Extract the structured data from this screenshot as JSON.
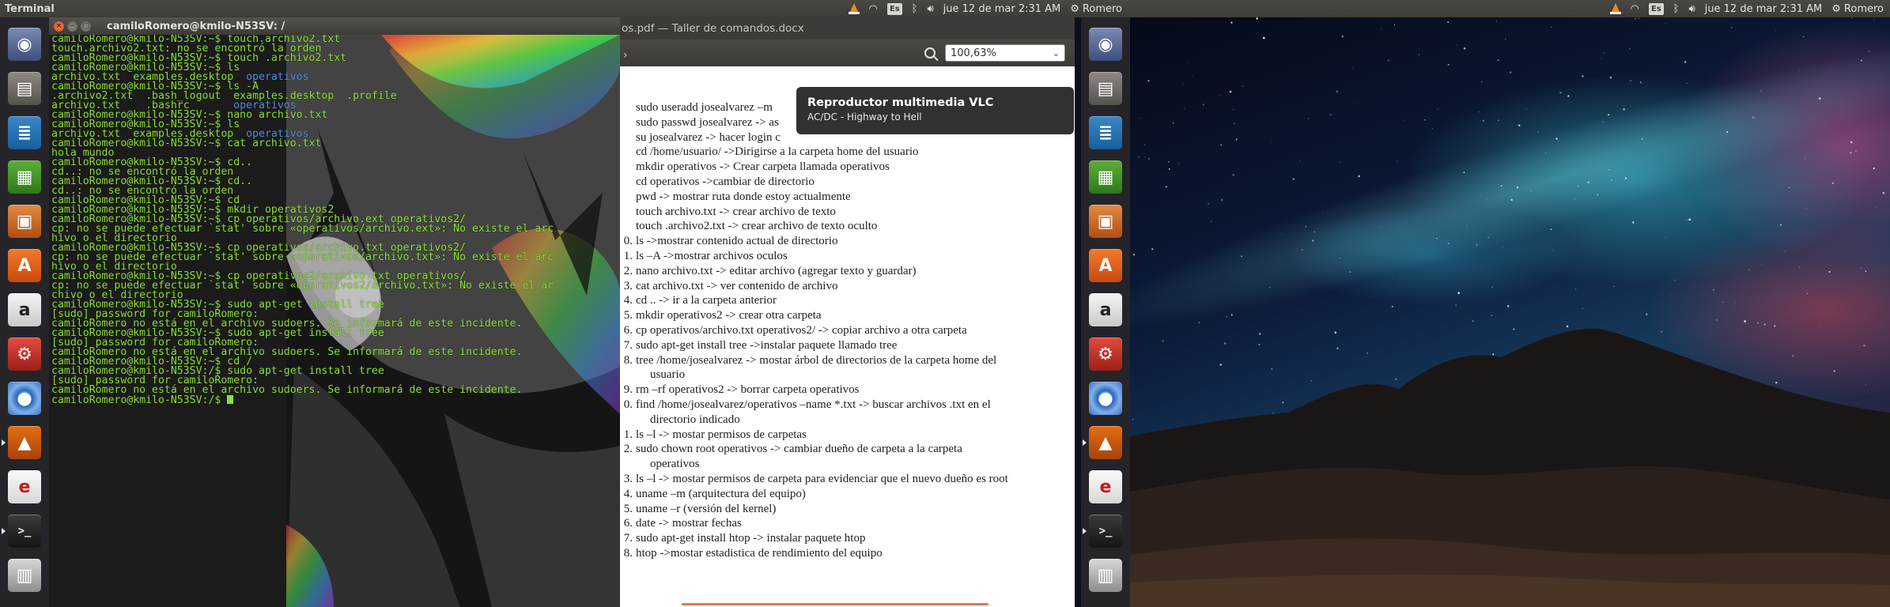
{
  "left_panel": {
    "app_title": "Terminal",
    "keyboard_layout": "Es",
    "datetime": "jue 12 de mar  2:31 AM",
    "username": "Romero"
  },
  "right_panel": {
    "keyboard_layout": "Es",
    "datetime": "jue 12 de mar  2:31 AM",
    "username": "Romero"
  },
  "launcher": [
    {
      "name": "dash-home",
      "glyph": "◉"
    },
    {
      "name": "files",
      "glyph": "▤"
    },
    {
      "name": "libreoffice-writer",
      "glyph": "≣"
    },
    {
      "name": "libreoffice-calc",
      "glyph": "▦"
    },
    {
      "name": "libreoffice-impress",
      "glyph": "▣"
    },
    {
      "name": "ubuntu-software-center",
      "glyph": "A"
    },
    {
      "name": "amazon",
      "glyph": "a"
    },
    {
      "name": "system-settings",
      "glyph": "⚙"
    },
    {
      "name": "chromium",
      "glyph": "●"
    },
    {
      "name": "vlc",
      "glyph": "▲"
    },
    {
      "name": "help-desk",
      "glyph": "e"
    },
    {
      "name": "terminal",
      "glyph": ">_"
    },
    {
      "name": "trash",
      "glyph": "▥"
    }
  ],
  "terminal": {
    "title": "camiloRomero@kmilo-N53SV: /",
    "lines": [
      "camiloRomero@kmilo-N53SV:~$ touch.archivo2.txt",
      "touch.archivo2.txt: no se encontró la orden",
      "camiloRomero@kmilo-N53SV:~$ touch .archivo2.txt",
      "camiloRomero@kmilo-N53SV:~$ ls",
      "archivo.txt  examples.desktop  operativos",
      "camiloRomero@kmilo-N53SV:~$ ls -A",
      ".archivo2.txt  .bash_logout  examples.desktop  .profile",
      "archivo.txt    .bashrc       operativos",
      "camiloRomero@kmilo-N53SV:~$ nano archivo.txt",
      "camiloRomero@kmilo-N53SV:~$ ls",
      "archivo.txt  examples.desktop  operativos",
      "camiloRomero@kmilo-N53SV:~$ cat archivo.txt",
      "hola mundo",
      "camiloRomero@kmilo-N53SV:~$ cd..",
      "cd..: no se encontró la orden",
      "camiloRomero@kmilo-N53SV:~$ cd..",
      "cd..: no se encontró la orden",
      "camiloRomero@kmilo-N53SV:~$ cd",
      "camiloRomero@kmilo-N53SV:~$ mkdir operativos2",
      "camiloRomero@kmilo-N53SV:~$ cp operativos/archivo.ext operativos2/",
      "cp: no se puede efectuar `stat' sobre «operativos/archivo.ext»: No existe el arc",
      "hivo o el directorio",
      "camiloRomero@kmilo-N53SV:~$ cp operativos/archivo.txt operativos2/",
      "cp: no se puede efectuar `stat' sobre «operativos/archivo.txt»: No existe el arc",
      "hivo o el directorio",
      "camiloRomero@kmilo-N53SV:~$ cp operativos2/archivo.txt operativos/",
      "cp: no se puede efectuar `stat' sobre «operativos2/archivo.txt»: No existe el ar",
      "chivo o el directorio",
      "camiloRomero@kmilo-N53SV:~$ sudo apt-get install tree",
      "[sudo] password for camiloRomero:",
      "camiloRomero no está en el archivo sudoers. Se informará de este incidente.",
      "camiloRomero@kmilo-N53SV:~$ sudo apt-get install tree",
      "[sudo] password for camiloRomero:",
      "camiloRomero no está en el archivo sudoers. Se informará de este incidente.",
      "camiloRomero@kmilo-N53SV:~$ cd /",
      "camiloRomero@kmilo-N53SV:/$ sudo apt-get install tree",
      "[sudo] password for camiloRomero:",
      "camiloRomero no está en el archivo sudoers. Se informará de este incidente.",
      "camiloRomero@kmilo-N53SV:/$ "
    ]
  },
  "document_viewer": {
    "title": "os.pdf — Taller de comandos.docx",
    "zoom": "100,63%",
    "lines": [
      {
        "num": "",
        "text": "sudo  useradd josealvarez –m"
      },
      {
        "num": "",
        "text": "sudo passwd josealvarez -> as"
      },
      {
        "num": "",
        "text": "su josealvarez -> hacer login c"
      },
      {
        "num": "",
        "text": "cd /home/usuario/ ->Dirigirse a la carpeta home del usuario"
      },
      {
        "num": "",
        "text": "mkdir operativos -> Crear carpeta llamada operativos"
      },
      {
        "num": "",
        "text": "cd operativos ->cambiar de directorio"
      },
      {
        "num": "",
        "text": "pwd -> mostrar ruta donde estoy actualmente"
      },
      {
        "num": "",
        "text": "touch archivo.txt -> crear archivo de texto"
      },
      {
        "num": "",
        "text": "touch .archivo2.txt -> crear archivo de texto oculto"
      },
      {
        "num": "0.",
        "text": "ls ->mostrar contenido actual de directorio"
      },
      {
        "num": "1.",
        "text": "ls –A ->mostrar archivos oculos"
      },
      {
        "num": "2.",
        "text": "nano archivo.txt -> editar archivo (agregar texto y guardar)"
      },
      {
        "num": "3.",
        "text": "cat archivo.txt -> ver contenido de archivo"
      },
      {
        "num": "4.",
        "text": "cd .. -> ir a la carpeta anterior"
      },
      {
        "num": "5.",
        "text": "mkdir operativos2 -> crear otra carpeta"
      },
      {
        "num": "6.",
        "text": "cp operativos/archivo.txt operativos2/ -> copiar archivo a otra carpeta"
      },
      {
        "num": "7.",
        "text": "sudo apt-get install tree ->instalar paquete llamado tree"
      },
      {
        "num": "8.",
        "text": "tree /home/josealvarez -> mostar árbol de directorios de la carpeta home del"
      },
      {
        "num": "",
        "text": "usuario",
        "cont": true
      },
      {
        "num": "9.",
        "text": "rm –rf operativos2 -> borrar carpeta operativos"
      },
      {
        "num": "0.",
        "text": "find /home/josealvarez/operativos –name *.txt -> buscar archivos .txt en el"
      },
      {
        "num": "",
        "text": "directorio indicado",
        "cont": true
      },
      {
        "num": "1.",
        "text": "ls –l -> mostar permisos de carpetas"
      },
      {
        "num": "2.",
        "text": "sudo chown root operativos -> cambiar dueño de carpeta a la carpeta"
      },
      {
        "num": "",
        "text": "operativos",
        "cont": true
      },
      {
        "num": "3.",
        "text": "ls –l -> mostar permisos de carpeta para evidenciar que el nuevo dueño es root"
      },
      {
        "num": "4.",
        "text": "uname –m (arquitectura del equipo)"
      },
      {
        "num": "5.",
        "text": "uname –r (versión del kernel)"
      },
      {
        "num": "6.",
        "text": "date -> mostrar fechas"
      },
      {
        "num": "7.",
        "text": "sudo apt-get install htop -> instalar paquete htop"
      },
      {
        "num": "8.",
        "text": "htop ->mostar estadistica de rendimiento del equipo"
      }
    ]
  },
  "notification": {
    "title": "Reproductor multimedia VLC",
    "body": "AC/DC - Highway to Hell"
  },
  "colors": {
    "panel_bg": "#3c3b37",
    "terminal_prompt_green": "#8ae234",
    "terminal_dir_blue": "#4f8ee6",
    "window_close_orange": "#e0582c",
    "scrollbar_orange": "#e8774a"
  }
}
